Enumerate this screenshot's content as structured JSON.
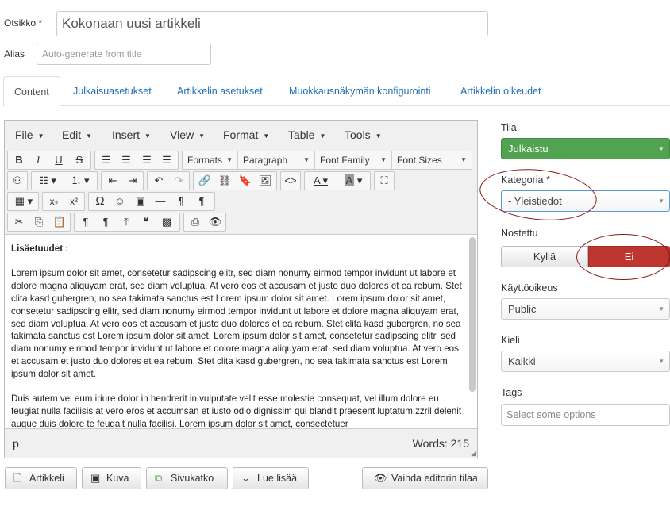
{
  "form": {
    "title_label": "Otsikko *",
    "title_value": "Kokonaan uusi artikkeli",
    "alias_label": "Alias",
    "alias_placeholder": "Auto-generate from title"
  },
  "tabs": [
    {
      "label": "Content",
      "active": true
    },
    {
      "label": "Julkaisuasetukset"
    },
    {
      "label": "Artikkelin asetukset"
    },
    {
      "label": "Muokkausnäkymän konfigurointi"
    },
    {
      "label": "Artikkelin oikeudet"
    }
  ],
  "editor": {
    "menus": [
      "File",
      "Edit",
      "Insert",
      "View",
      "Format",
      "Table",
      "Tools"
    ],
    "selects": {
      "formats": "Formats",
      "paragraph": "Paragraph",
      "font_family": "Font Family",
      "font_sizes": "Font Sizes"
    },
    "heading": "Lisäetuudet :",
    "paragraph1": "Lorem ipsum dolor sit amet, consetetur sadipscing elitr, sed diam nonumy eirmod tempor invidunt ut labore et dolore magna aliquyam erat, sed diam voluptua. At vero eos et accusam et justo duo dolores et ea rebum. Stet clita kasd gubergren, no sea takimata sanctus est Lorem ipsum dolor sit amet. Lorem ipsum dolor sit amet, consetetur sadipscing elitr, sed diam nonumy eirmod tempor invidunt ut labore et dolore magna aliquyam erat, sed diam voluptua. At vero eos et accusam et justo duo dolores et ea rebum. Stet clita kasd gubergren, no sea takimata sanctus est Lorem ipsum dolor sit amet. Lorem ipsum dolor sit amet, consetetur sadipscing elitr, sed diam nonumy eirmod tempor invidunt ut labore et dolore magna aliquyam erat, sed diam voluptua. At vero eos et accusam et justo duo dolores et ea rebum. Stet clita kasd gubergren, no sea takimata sanctus est Lorem ipsum dolor sit amet.",
    "paragraph2": "Duis autem vel eum iriure dolor in hendrerit in vulputate velit esse molestie consequat, vel illum dolore eu feugiat nulla facilisis at vero eros et accumsan et iusto odio dignissim qui blandit praesent luptatum zzril delenit augue duis dolore te feugait nulla facilisi. Lorem ipsum dolor sit amet, consectetuer",
    "path": "p",
    "word_count": "Words: 215"
  },
  "buttons": {
    "article": "Artikkeli",
    "image": "Kuva",
    "pagebreak": "Sivukatko",
    "readmore": "Lue lisää",
    "toggle_editor": "Vaihda editorin tilaa"
  },
  "sidebar": {
    "state_label": "Tila",
    "state_value": "Julkaistu",
    "category_label": "Kategoria *",
    "category_value": "- Yleistiedot",
    "featured_label": "Nostettu",
    "featured_yes": "Kyllä",
    "featured_no": "Ei",
    "access_label": "Käyttöoikeus",
    "access_value": "Public",
    "language_label": "Kieli",
    "language_value": "Kaikki",
    "tags_label": "Tags",
    "tags_placeholder": "Select some options"
  },
  "colors": {
    "published": "#51a351",
    "featured_no": "#bd362f",
    "link": "#1f6fb5",
    "annotation": "#8b1a1a"
  }
}
